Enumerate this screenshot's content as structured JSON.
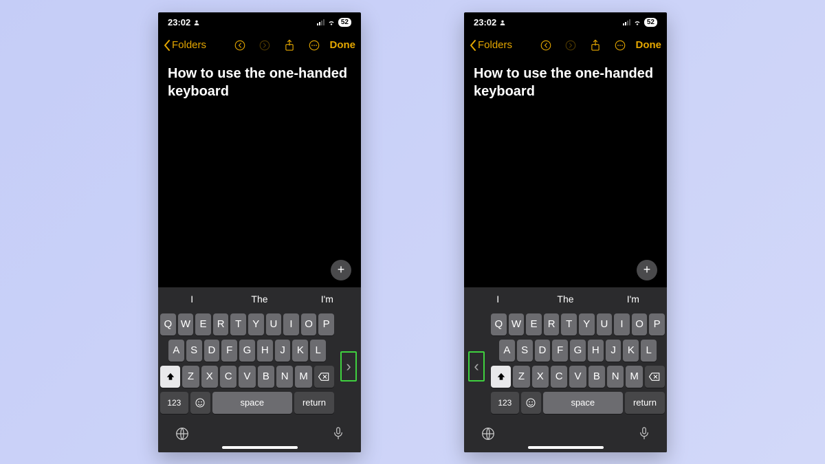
{
  "status": {
    "time": "23:02",
    "battery": "52"
  },
  "nav": {
    "back": "Folders",
    "done": "Done"
  },
  "note": {
    "title": "How to use the one-handed keyboard"
  },
  "suggestions": [
    "I",
    "The",
    "I'm"
  ],
  "keys": {
    "row1": [
      "Q",
      "W",
      "E",
      "R",
      "T",
      "Y",
      "U",
      "I",
      "O",
      "P"
    ],
    "row2": [
      "A",
      "S",
      "D",
      "F",
      "G",
      "H",
      "J",
      "K",
      "L"
    ],
    "row3": [
      "Z",
      "X",
      "C",
      "V",
      "B",
      "N",
      "M"
    ],
    "num": "123",
    "space": "space",
    "ret": "return"
  },
  "expand": {
    "left_glyph": "›",
    "right_glyph": "‹"
  }
}
